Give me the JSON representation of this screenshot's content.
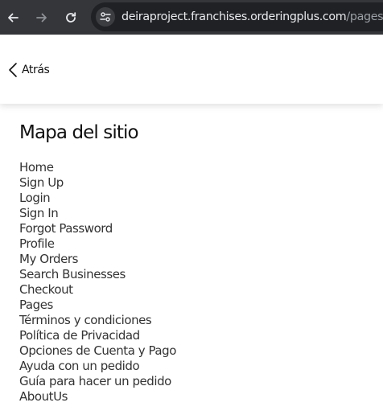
{
  "browser": {
    "url_domain": "deiraproject.franchises.orderingplus.com",
    "url_path": "/pages"
  },
  "header": {
    "back_label": "Atrás"
  },
  "main": {
    "title": "Mapa del sitio",
    "links": [
      "Home",
      "Sign Up",
      "Login",
      "Sign In",
      "Forgot Password",
      "Profile",
      "My Orders",
      "Search Businesses",
      "Checkout",
      "Pages",
      "Términos y condiciones",
      "Política de Privacidad",
      "Opciones de Cuenta y Pago",
      "Ayuda con un pedido",
      "Guía para hacer un pedido",
      "AboutUs"
    ]
  }
}
